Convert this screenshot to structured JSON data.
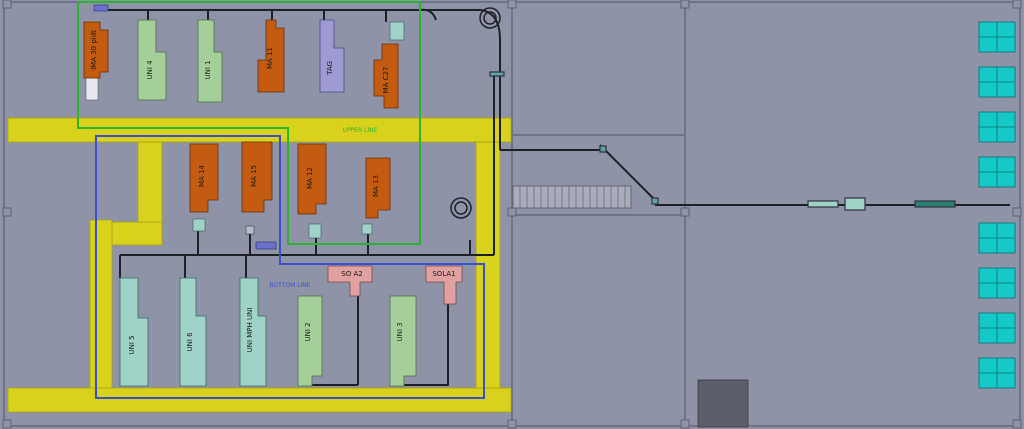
{
  "zones": {
    "upper": {
      "label": "UPPER LINE",
      "color": "#2bb52b"
    },
    "bottom": {
      "label": "BOTTOM LINE",
      "color": "#3a4fd0"
    }
  },
  "machines": {
    "ima_sp": "IMA 30 pidt",
    "uni4": "UNI 4",
    "uni1": "UNI 1",
    "ma11": "MA 11",
    "tag": "TAG",
    "mac27": "MA C27",
    "ma14": "MA 14",
    "ma15": "MA 15",
    "ma12": "MA 12",
    "ma13": "MA 13",
    "uni5": "UNI 5",
    "uni6": "UNI 6",
    "unimph": "UNI MPH UNI",
    "uni2": "UNI 2",
    "uni3": "UNI 3",
    "soa2": "SO A2",
    "soa1": "SOLA1"
  },
  "colors": {
    "floor": "#8f93a8",
    "wall": "#767a8e",
    "aisle": "#d9d21c",
    "machine_orange": "#c35c10",
    "machine_green": "#a4cf98",
    "machine_teal": "#9fd3c8",
    "machine_purple": "#9d9bd1",
    "machine_pink": "#e2a1a1",
    "rack_cyan": "#15c9c9",
    "conveyor": "#1e2028"
  }
}
